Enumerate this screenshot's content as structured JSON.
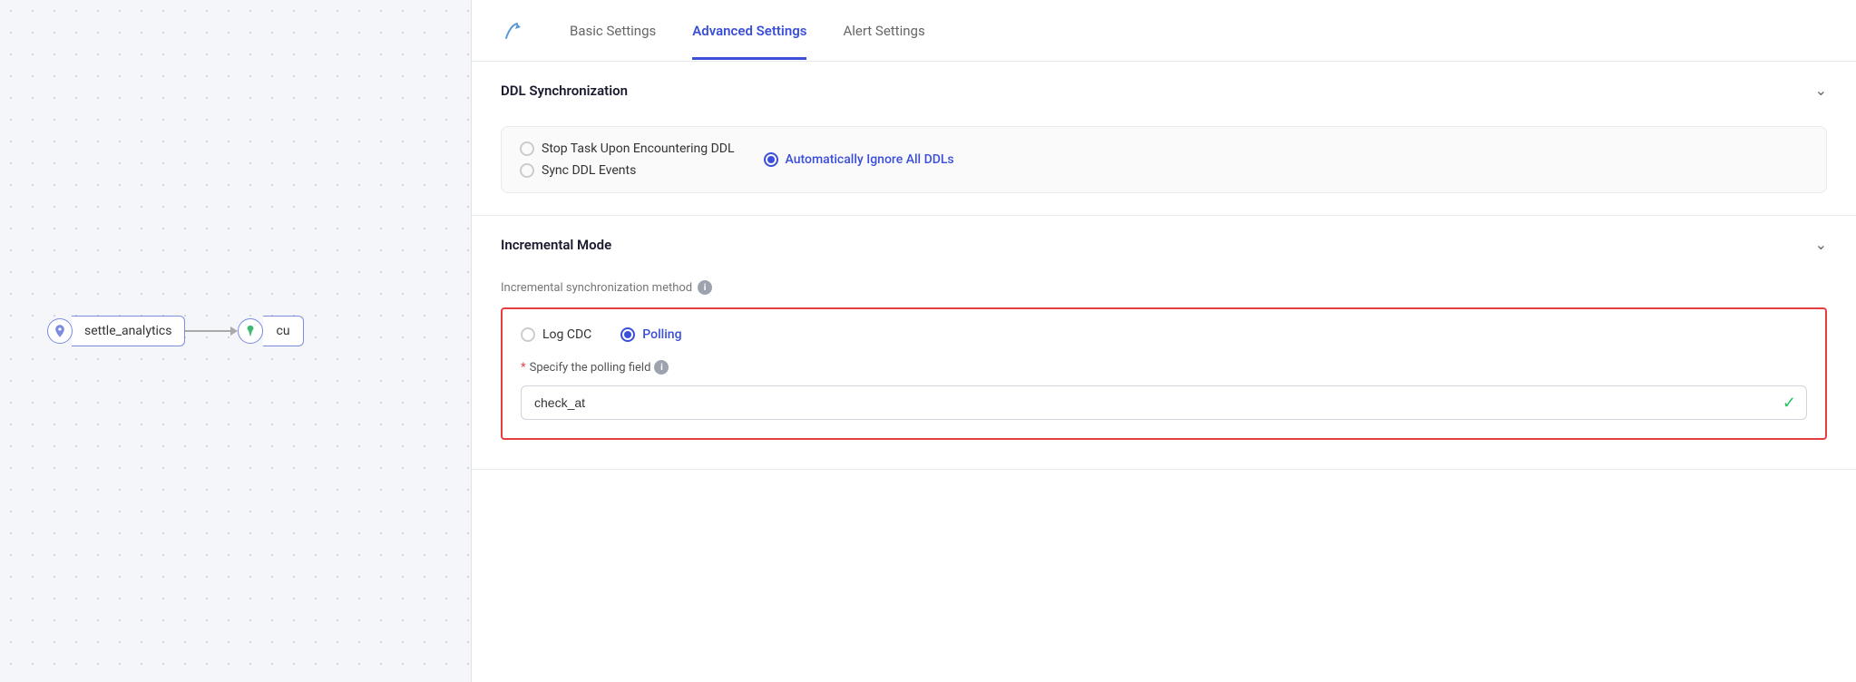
{
  "canvas": {
    "source_node": {
      "label": "settle_analytics",
      "icon_type": "leaf"
    },
    "dest_node": {
      "label": "cu",
      "icon_type": "drop"
    }
  },
  "tabs": [
    {
      "id": "basic",
      "label": "Basic Settings",
      "active": false
    },
    {
      "id": "advanced",
      "label": "Advanced Settings",
      "active": true
    },
    {
      "id": "alert",
      "label": "Alert Settings",
      "active": false
    }
  ],
  "sections": {
    "ddl_sync": {
      "title": "DDL Synchronization",
      "options": [
        {
          "id": "stop_task",
          "label": "Stop Task Upon Encountering DDL",
          "checked": false
        },
        {
          "id": "sync_ddl",
          "label": "Sync DDL Events",
          "checked": false
        },
        {
          "id": "auto_ignore",
          "label": "Automatically Ignore All DDLs",
          "checked": true
        }
      ]
    },
    "incremental_mode": {
      "title": "Incremental Mode",
      "sub_label": "Incremental synchronization method",
      "methods": [
        {
          "id": "log_cdc",
          "label": "Log CDC",
          "checked": false
        },
        {
          "id": "polling",
          "label": "Polling",
          "checked": true
        }
      ],
      "polling_field_label": "Specify the polling field",
      "polling_field_value": "check_at"
    }
  },
  "icons": {
    "leaf": "🌿",
    "drop": "💧",
    "chevron_down": "∨",
    "info": "i",
    "check": "✓"
  },
  "colors": {
    "active_tab": "#3b4fd8",
    "active_radio": "#3b4fd8",
    "required": "#e53e3e",
    "highlight_border": "#e53e3e",
    "active_label": "#3b4fd8"
  }
}
